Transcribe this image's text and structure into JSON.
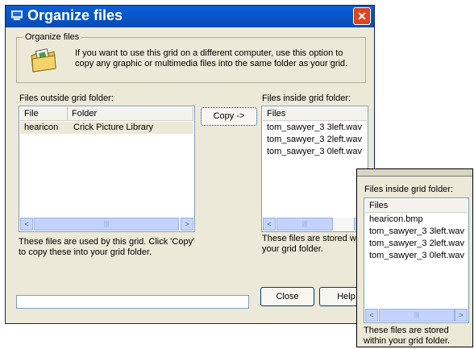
{
  "window": {
    "title": "Organize files",
    "close_label": "✕"
  },
  "group": {
    "label": "Organize files",
    "info": "If you want to use this grid on a different computer, use this option to copy any graphic or multimedia files into the same folder as your grid."
  },
  "outside": {
    "label": "Files outside grid folder:",
    "columns": [
      "File",
      "Folder"
    ],
    "rows": [
      {
        "file": "hearicon",
        "folder": "Crick Picture Library"
      }
    ],
    "description": "These files are used by this grid.  Click 'Copy' to copy these into your grid folder."
  },
  "copy_button": "Copy ->",
  "inside": {
    "label": "Files inside grid folder:",
    "column": "Files",
    "rows": [
      "tom_sawyer_3 3left.wav",
      "tom_sawyer_3 2left.wav",
      "tom_sawyer_3 0left.wav"
    ],
    "description": "These files are stored within your grid folder."
  },
  "buttons": {
    "close": "Close",
    "help": "Help"
  },
  "overlay": {
    "label": "Files inside grid folder:",
    "column": "Files",
    "rows": [
      "hearicon.bmp",
      "tom_sawyer_3 3left.wav",
      "tom_sawyer_3 2left.wav",
      "tom_sawyer_3 0left.wav"
    ],
    "description": "These files are stored within your grid folder."
  },
  "scrollbar": {
    "left_arrow": "<",
    "right_arrow": ">",
    "grip": "|||"
  }
}
